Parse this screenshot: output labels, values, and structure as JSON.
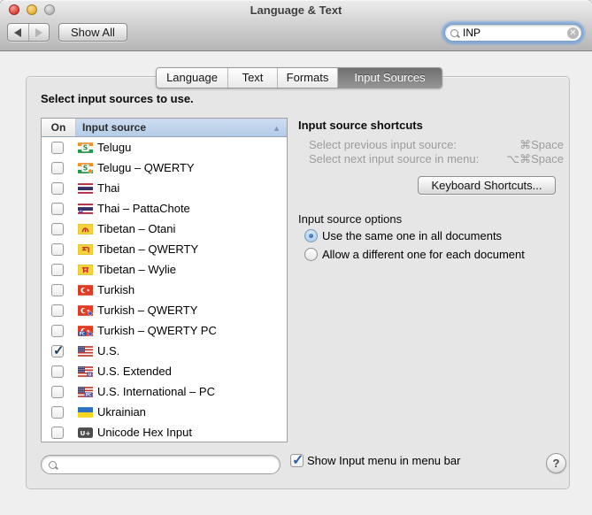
{
  "window": {
    "title": "Language & Text"
  },
  "toolbar": {
    "show_all_label": "Show All",
    "search": {
      "value": "INP"
    }
  },
  "tabs": [
    {
      "label": "Language",
      "selected": false
    },
    {
      "label": "Text",
      "selected": false
    },
    {
      "label": "Formats",
      "selected": false
    },
    {
      "label": "Input Sources",
      "selected": true
    }
  ],
  "main": {
    "select_label": "Select input sources to use.",
    "table": {
      "columns": [
        "On",
        "Input source"
      ],
      "sort": "ascending",
      "rows": [
        {
          "label": "Telugu",
          "icon": "telugu-flag-icon",
          "checked": false
        },
        {
          "label": "Telugu – QWERTY",
          "icon": "telugu-qwerty-flag-icon",
          "checked": false
        },
        {
          "label": "Thai",
          "icon": "thai-flag-icon",
          "checked": false
        },
        {
          "label": "Thai – PattaChote",
          "icon": "thai-pattachote-flag-icon",
          "checked": false
        },
        {
          "label": "Tibetan – Otani",
          "icon": "tibetan-otani-flag-icon",
          "checked": false
        },
        {
          "label": "Tibetan – QWERTY",
          "icon": "tibetan-qwerty-flag-icon",
          "checked": false
        },
        {
          "label": "Tibetan – Wylie",
          "icon": "tibetan-wylie-flag-icon",
          "checked": false
        },
        {
          "label": "Turkish",
          "icon": "turkish-flag-icon",
          "checked": false
        },
        {
          "label": "Turkish – QWERTY",
          "icon": "turkish-qwerty-flag-icon",
          "checked": false
        },
        {
          "label": "Turkish – QWERTY PC",
          "icon": "turkish-qwerty-pc-flag-icon",
          "checked": false
        },
        {
          "label": "U.S.",
          "icon": "us-flag-icon",
          "checked": true
        },
        {
          "label": "U.S. Extended",
          "icon": "us-extended-flag-icon",
          "checked": false
        },
        {
          "label": "U.S. International – PC",
          "icon": "us-international-pc-flag-icon",
          "checked": false
        },
        {
          "label": "Ukrainian",
          "icon": "ukrainian-flag-icon",
          "checked": false
        },
        {
          "label": "Unicode Hex Input",
          "icon": "unicode-hex-icon",
          "checked": false
        }
      ]
    }
  },
  "shortcuts": {
    "title": "Input source shortcuts",
    "items": [
      {
        "label": "Select previous input source:",
        "value": "⌘Space"
      },
      {
        "label": "Select next input source in menu:",
        "value": "⌥⌘Space"
      }
    ],
    "button_label": "Keyboard Shortcuts..."
  },
  "options": {
    "title": "Input source options",
    "radios": [
      {
        "label": "Use the same one in all documents",
        "selected": true
      },
      {
        "label": "Allow a different one for each document",
        "selected": false
      }
    ]
  },
  "footer": {
    "show_input_menu_label": "Show Input menu in menu bar",
    "show_input_menu_checked": true,
    "help_label": "?"
  },
  "colors": {
    "selected_tab": "#7c7c7c",
    "sorted_header": "#bfd3ea",
    "focus_ring": "#6fa2df",
    "check_blue": "#2d62a8",
    "check_navy": "#21405f"
  }
}
